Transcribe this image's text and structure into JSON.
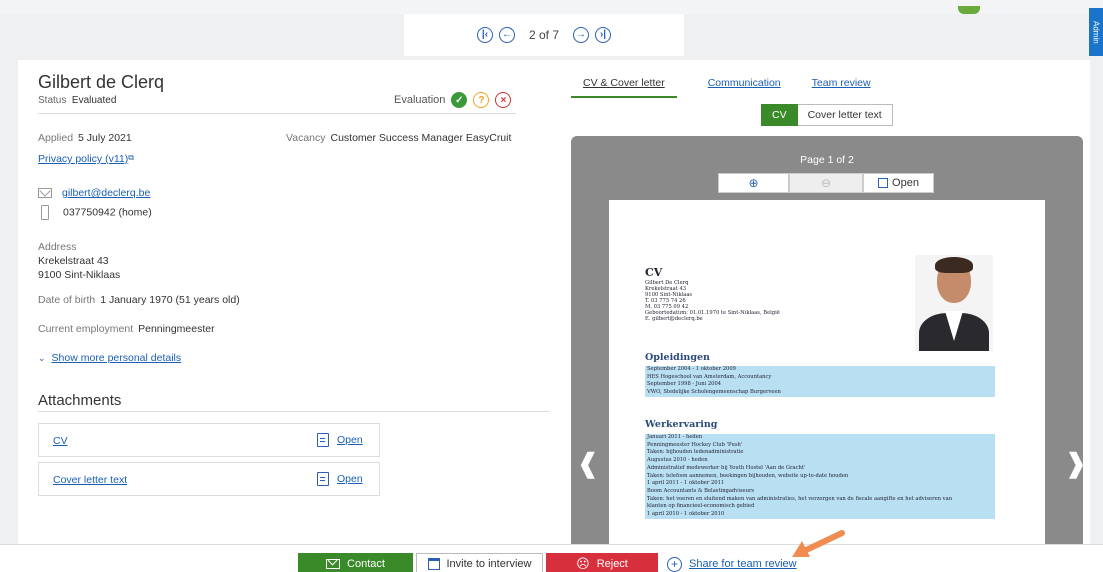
{
  "pager": {
    "current": "2 of 7"
  },
  "side_tab": {
    "label": "Admin"
  },
  "candidate": {
    "name": "Gilbert de Clerq",
    "status_label": "Status",
    "status_value": "Evaluated",
    "evaluation_label": "Evaluation",
    "applied_label": "Applied",
    "applied_value": "5 July 2021",
    "vacancy_label": "Vacancy",
    "vacancy_value": "Customer Success Manager EasyCruit",
    "privacy_link": "Privacy policy (v11)",
    "email": "gilbert@declerq.be",
    "phone": "037750942 (home)",
    "address_label": "Address",
    "address_line1": "Krekelstraat 43",
    "address_line2": "9100 Sint-Niklaas",
    "dob_label": "Date of birth",
    "dob_value": "1 January 1970 (51 years old)",
    "employment_label": "Current employment",
    "employment_value": "Penningmeester",
    "more_details_link": "Show more personal details"
  },
  "attachments": {
    "title": "Attachments",
    "items": [
      {
        "label": "CV",
        "action": "Open"
      },
      {
        "label": "Cover letter text",
        "action": "Open"
      }
    ]
  },
  "right_tabs": [
    "CV & Cover letter",
    "Communication",
    "Team review"
  ],
  "doc_toggle": {
    "cv": "CV",
    "cover": "Cover letter text"
  },
  "viewer": {
    "page_label": "Page 1 of 2",
    "open_label": "Open",
    "document": {
      "heading": "CV",
      "info_lines": [
        "Gilbert De Clerq",
        "Krekelstraat 43",
        "9100 Sint-Niklaas",
        "T. 03 775 74 26",
        "M. 03 775 09 42",
        "Geboortedatum: 01.01.1970 te Sint-Niklaas, België",
        "E. gilbert@declerq.be"
      ],
      "education_title": "Opleidingen",
      "education_lines": [
        "September 2004 - 1 oktober 2009",
        "HES Hogeschool van Amsterdam, Accountancy",
        "September 1998 - Juni 2004",
        "VWO, Stedelijke Scholengemeenschap Burgerveen"
      ],
      "work_title": "Werkervaring",
      "work_lines": [
        "Januari 2011 - heden",
        "Penningmeester Hockey Club 'Push'",
        "Taken: bijhouden ledenadministratie",
        "Augustus 2010 - heden",
        "Administratief medewerker bij Youth Hostel 'Aan de Gracht'",
        "Taken: telefoon aannemen, boekingen bijhouden, website up-to-date houden",
        "1 april 2011 - 1 oktober 2011",
        "Boom Accountants & Belastingadviseurs",
        "Taken: het voeren en sluitend maken van administraties, het verzorgen van de fiscale aangifte en het adviseren van",
        "klanten op financieel-economisch gebied",
        "1 april 2010 - 1 oktober 2010"
      ]
    }
  },
  "actions": {
    "contact": "Contact",
    "invite": "Invite to interview",
    "reject": "Reject",
    "share": "Share for team review"
  },
  "colors": {
    "green": "#3a8a2a",
    "red": "#d7303c",
    "link": "#1a5fb4",
    "highlight": "#b9dff3",
    "callout_arrow": "#f08c50"
  }
}
